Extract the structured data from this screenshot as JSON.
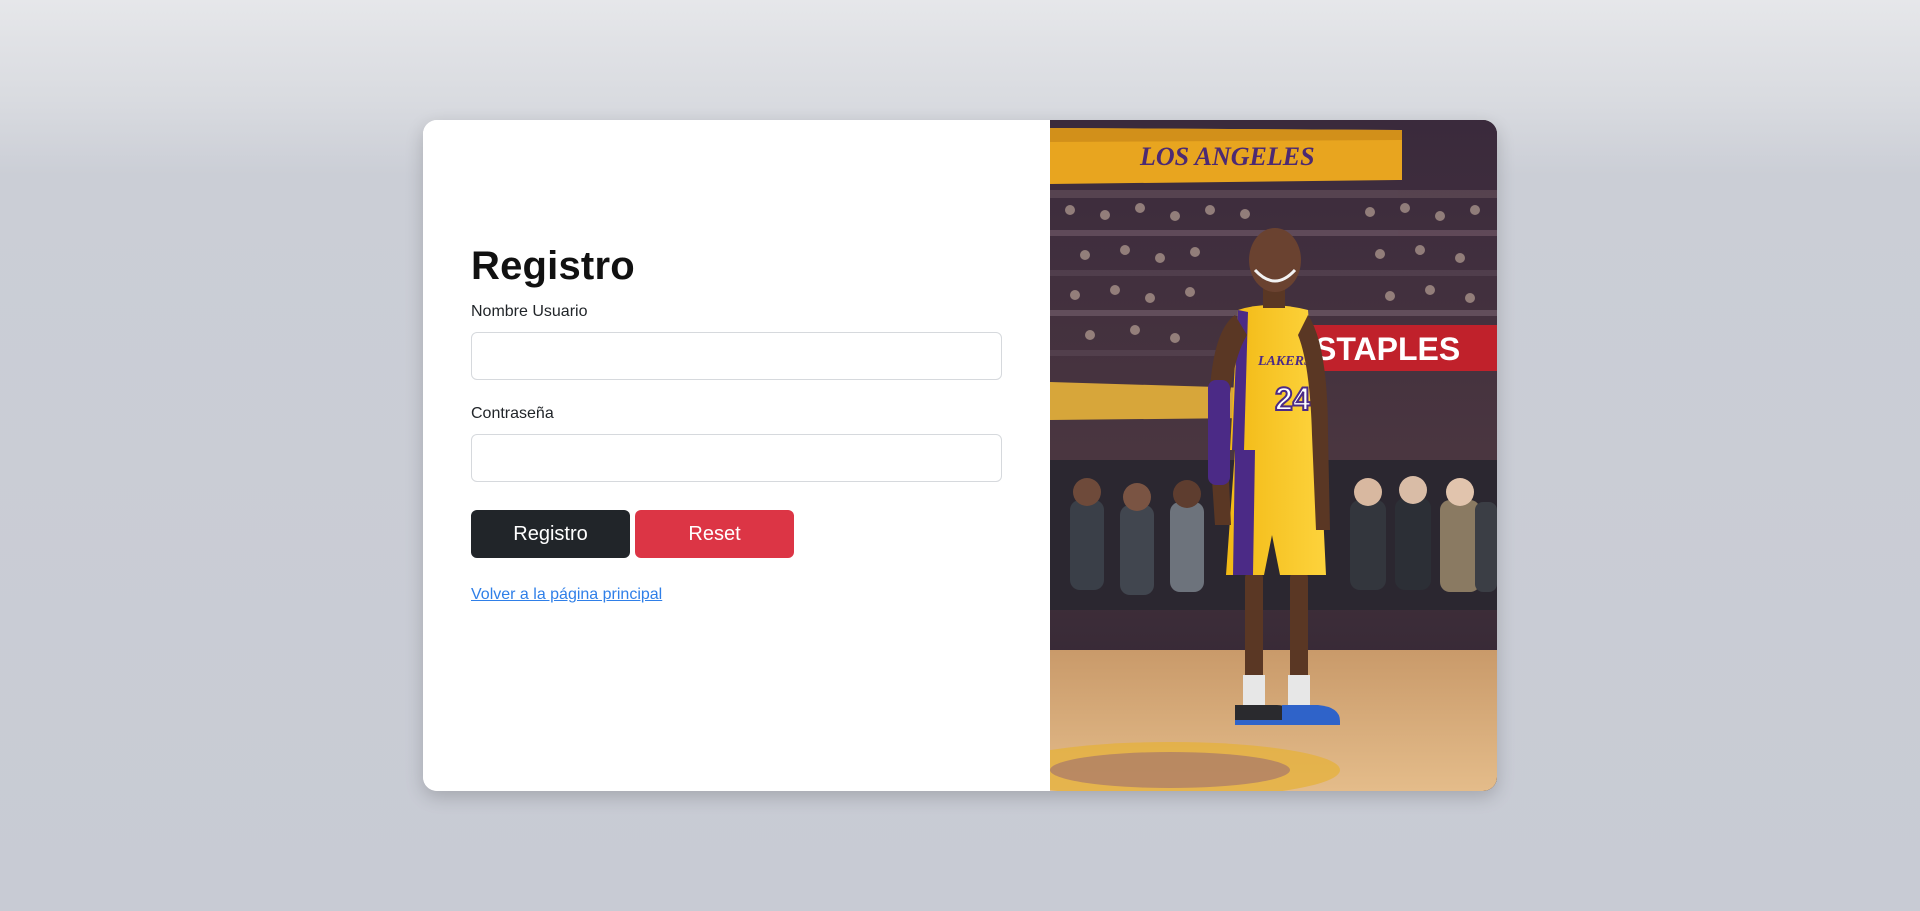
{
  "form": {
    "title": "Registro",
    "username_label": "Nombre Usuario",
    "username_value": "",
    "password_label": "Contraseña",
    "password_value": "",
    "submit_label": "Registro",
    "reset_label": "Reset",
    "back_link": "Volver a la página principal"
  },
  "image": {
    "banner_text": "LOS ANGELES",
    "signage_text": "STAPLES",
    "jersey_number": "24",
    "jersey_text": "LAKERS"
  },
  "colors": {
    "submit": "#212529",
    "reset": "#dc3545",
    "link": "#2f7fe8"
  }
}
